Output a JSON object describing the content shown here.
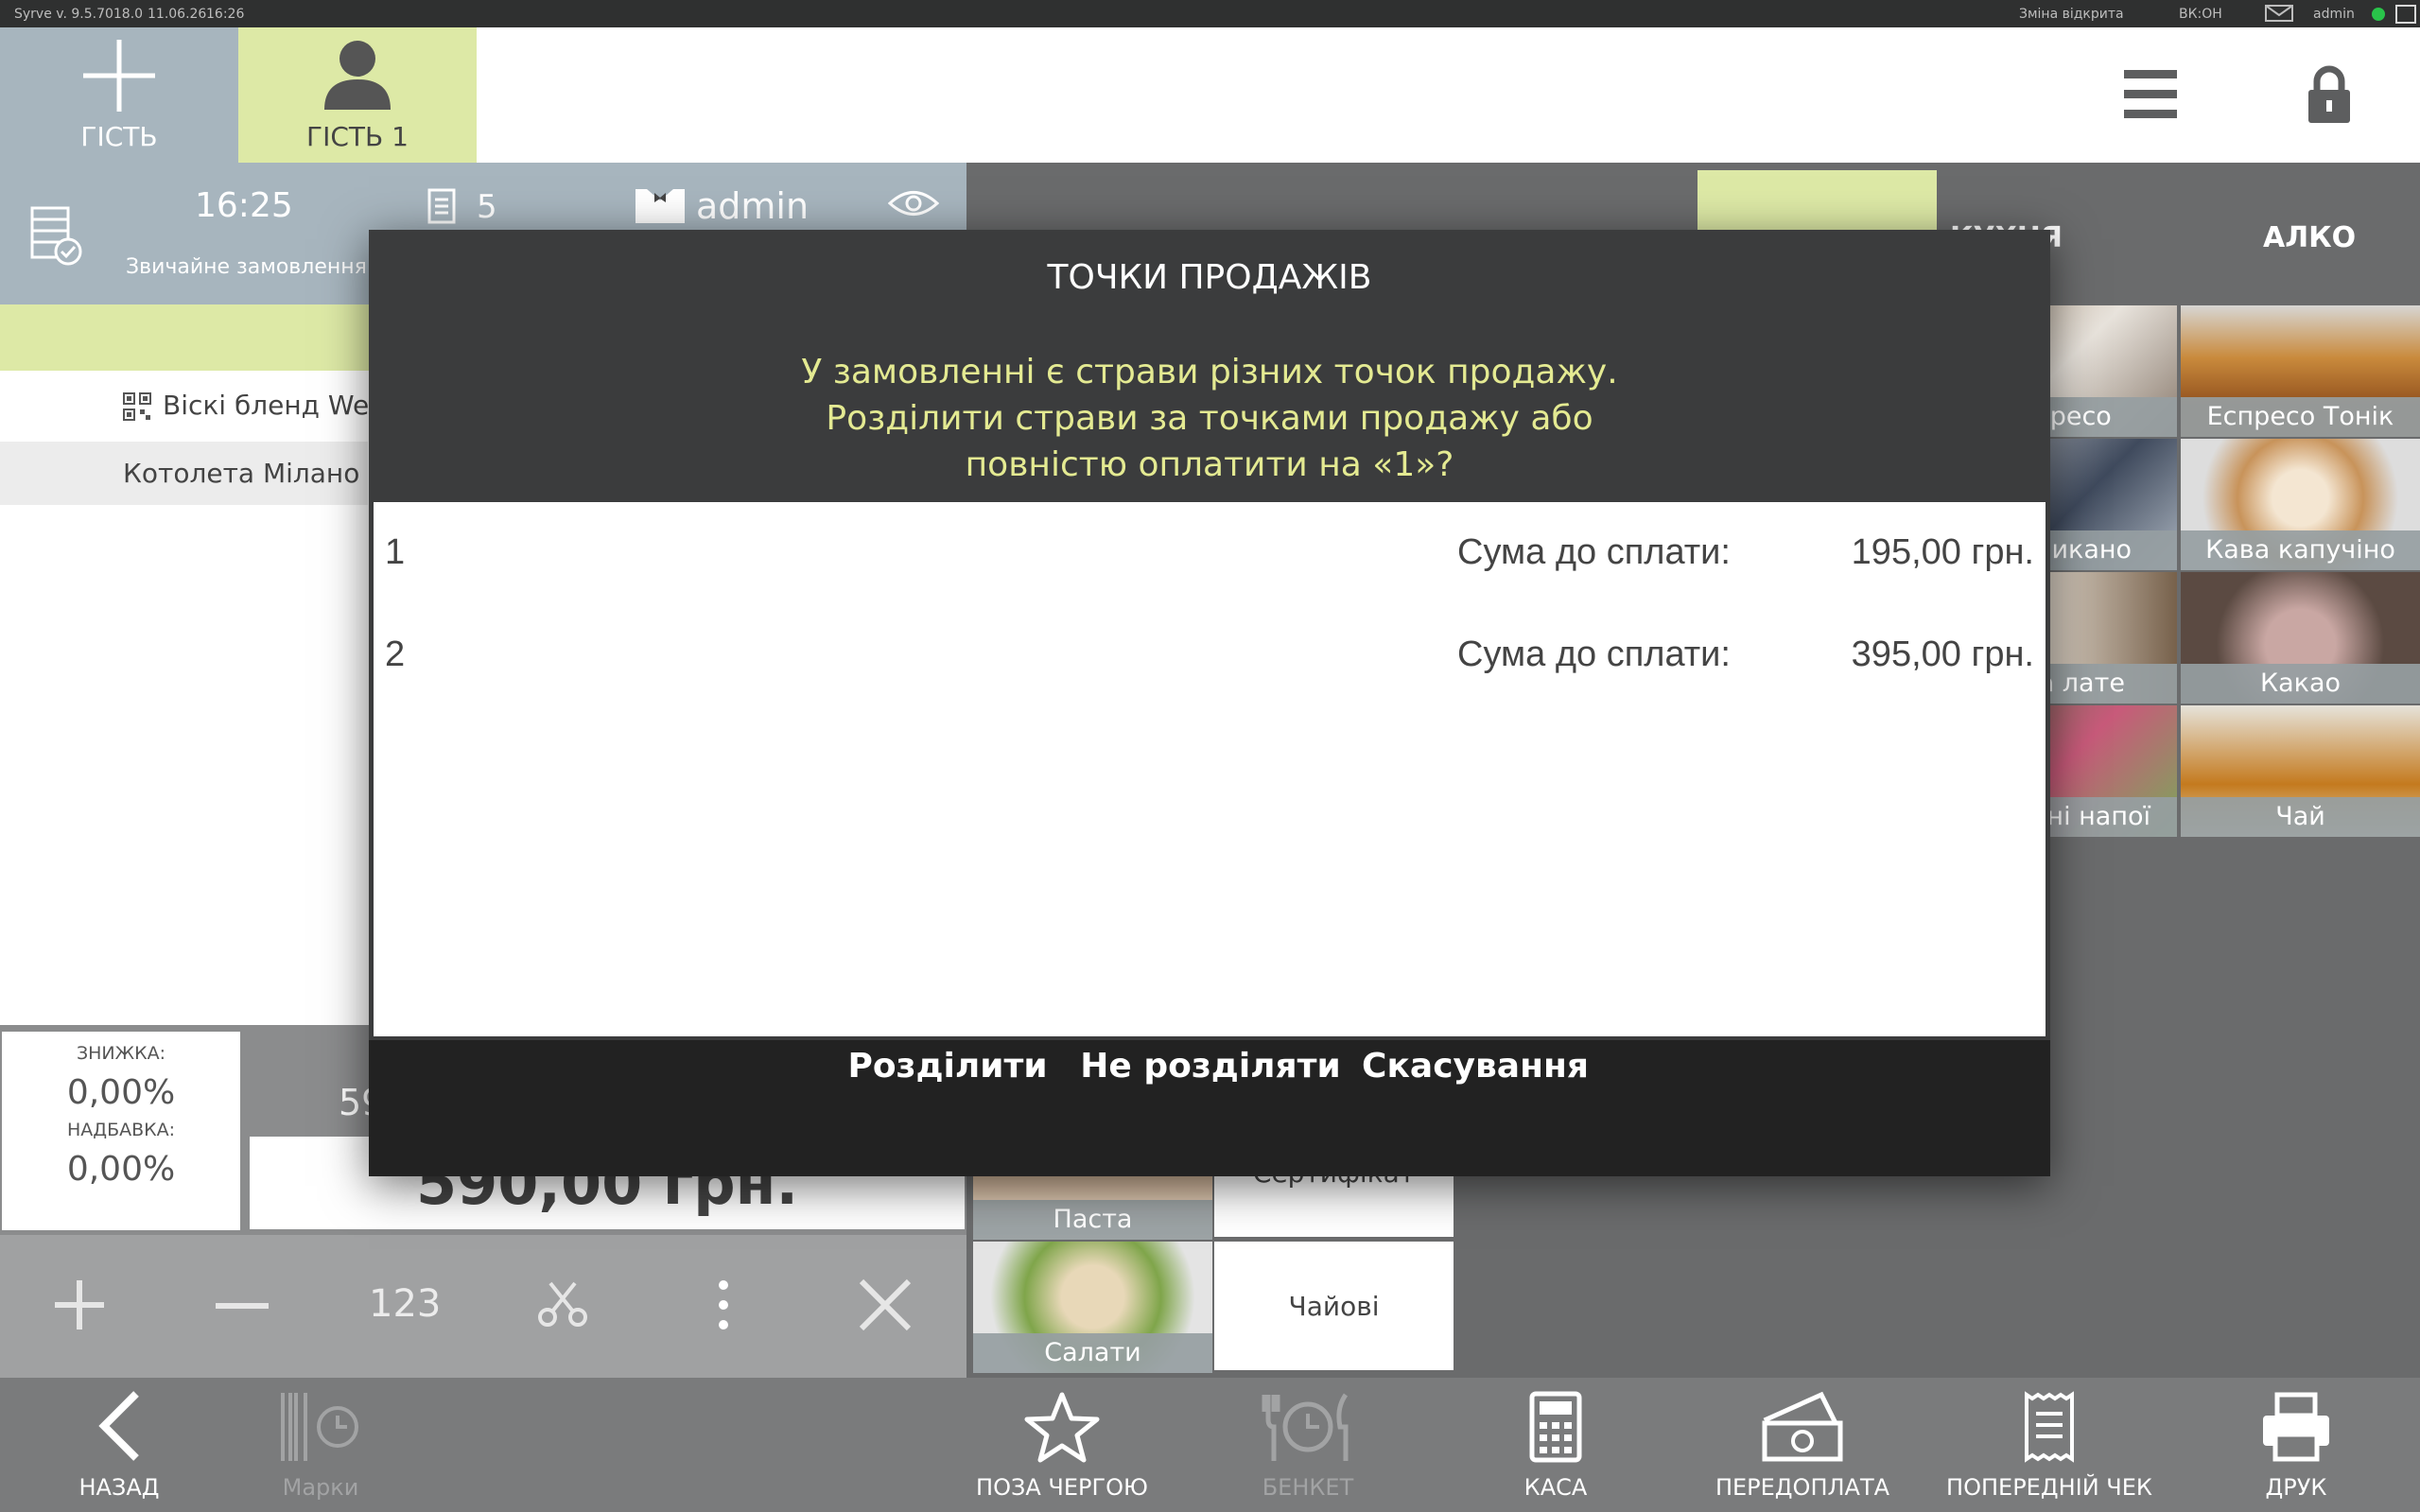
{
  "status_bar": {
    "version": "Syrve  v. 9.5.7018.0",
    "date": "11.06.26",
    "time": "16:26",
    "shift": "Зміна відкрита",
    "vk": "ВК:ОН",
    "user": "admin"
  },
  "guests": {
    "add_label": "ГІСТЬ",
    "guest1_label": "ГІСТЬ 1"
  },
  "order": {
    "time": "16:25",
    "type": "Звичайне замовлення",
    "count": "5",
    "waiter": "admin",
    "items": [
      {
        "name": "Віскі бленд West"
      },
      {
        "name": "Котолета Мілано"
      }
    ],
    "discount_label": "ЗНИЖКА:",
    "discount_value": "0,00%",
    "surcharge_label": "НАДБАВКА:",
    "surcharge_value": "0,00%",
    "subtotal_partial": "59",
    "total": "590,00 грн."
  },
  "order_toolbar": {
    "qty_label": "123"
  },
  "categories": {
    "tab_kitchen": "КУХНЯ",
    "tab_alko": "АЛКО"
  },
  "menu_tiles": [
    {
      "name": "Еспресо"
    },
    {
      "name": "Еспресо Тонік"
    },
    {
      "name": "Американо"
    },
    {
      "name": "Кава капучіно"
    },
    {
      "name": "Кава лате"
    },
    {
      "name": "Какао"
    },
    {
      "name": "Холодні напої"
    },
    {
      "name": "Чай"
    },
    {
      "name": "Паста"
    },
    {
      "name": "Салати"
    },
    {
      "name": "Сертифікат"
    },
    {
      "name": "Чайові"
    }
  ],
  "bottom_nav": {
    "back": "НАЗАД",
    "marks": "Марки",
    "out_of_queue": "ПОЗА ЧЕРГОЮ",
    "banquet": "БЕНКЕТ",
    "cash": "КАСА",
    "prepayment": "ПЕРЕДОПЛАТА",
    "pre_check": "ПОПЕРЕДНІЙ ЧЕК",
    "print": "ДРУК"
  },
  "dialog": {
    "title": "ТОЧКИ ПРОДАЖІВ",
    "message_lines": [
      "У замовленні є страви різних точок продажу.",
      "Розділити страви за точками продажу або",
      "повністю оплатити на «1»?"
    ],
    "rows": [
      {
        "id": "1",
        "label": "Сума до сплати:",
        "amount": "195,00 грн."
      },
      {
        "id": "2",
        "label": "Сума до сплати:",
        "amount": "395,00 грн."
      }
    ],
    "btn_split": "Розділити",
    "btn_no_split": "Не розділяти",
    "btn_cancel": "Скасування"
  },
  "colors": {
    "accent_yellow": "#dde9a6",
    "panel_gray": "#a7b5be",
    "dialog_dark": "#3b3c3d",
    "dialog_footer": "#222222",
    "dialog_text_yellow": "#e4ea92"
  }
}
